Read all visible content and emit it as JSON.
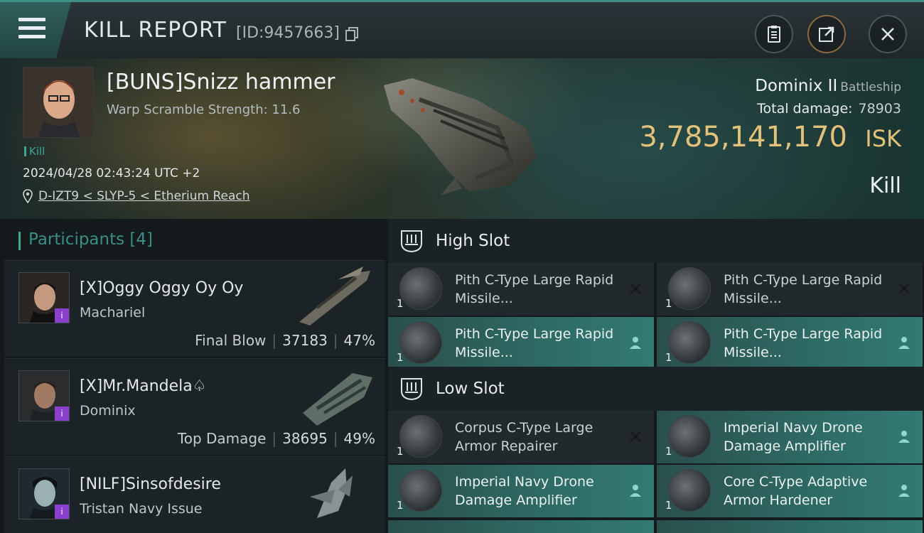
{
  "header": {
    "title": "KILL REPORT",
    "report_id": "[ID:9457663]",
    "icons": [
      "menu-icon",
      "copy-icon",
      "clipboard-icon",
      "share-icon",
      "close-icon"
    ]
  },
  "victim": {
    "pilot": "[BUNS]Snizz hammer",
    "warp_scramble": "Warp Scramble Strength: 11.6",
    "tag": "Kill",
    "datetime": "2024/04/28 02:43:24 UTC +2",
    "location": "D-IZT9 < SLYP-5 < Etherium Reach",
    "ship": "Dominix II",
    "ship_class": "Battleship",
    "total_damage_label": "Total damage:",
    "total_damage": "78903",
    "isk_value": "3,785,141,170",
    "isk_unit": "ISK",
    "result": "Kill"
  },
  "participants": {
    "title": "Participants",
    "count": "[4]",
    "list": [
      {
        "name": "[X]Oggy Oggy Oy Oy",
        "ship": "Machariel",
        "role": "Final Blow",
        "damage": "37183",
        "percent": "47%"
      },
      {
        "name": "[X]Mr.Mandela♤",
        "ship": "Dominix",
        "role": "Top Damage",
        "damage": "38695",
        "percent": "49%"
      },
      {
        "name": "[NILF]Sinsofdesire",
        "ship": "Tristan Navy Issue",
        "role": "",
        "damage": "",
        "percent": ""
      }
    ]
  },
  "fitting": {
    "high_slot": {
      "title": "High Slot",
      "modules": [
        {
          "name": "Pith C-Type Large Rapid Missile...",
          "qty": "1",
          "status": "destroyed"
        },
        {
          "name": "Pith C-Type Large Rapid Missile...",
          "qty": "1",
          "status": "destroyed"
        },
        {
          "name": "Pith C-Type Large Rapid Missile...",
          "qty": "1",
          "status": "dropped"
        },
        {
          "name": "Pith C-Type Large Rapid Missile...",
          "qty": "1",
          "status": "dropped"
        }
      ]
    },
    "low_slot": {
      "title": "Low Slot",
      "modules": [
        {
          "name": "Corpus C-Type Large Armor Repairer",
          "qty": "1",
          "status": "destroyed"
        },
        {
          "name": "Imperial Navy Drone Damage Amplifier",
          "qty": "1",
          "status": "dropped"
        },
        {
          "name": "Imperial Navy Drone Damage Amplifier",
          "qty": "1",
          "status": "dropped"
        },
        {
          "name": "Core C-Type Adaptive Armor Hardener",
          "qty": "1",
          "status": "dropped"
        }
      ]
    }
  },
  "colors": {
    "accent": "#3fa594",
    "isk": "#e2c27a",
    "fitted_row": "#2f6f69",
    "destroyed_row": "#22292c"
  }
}
